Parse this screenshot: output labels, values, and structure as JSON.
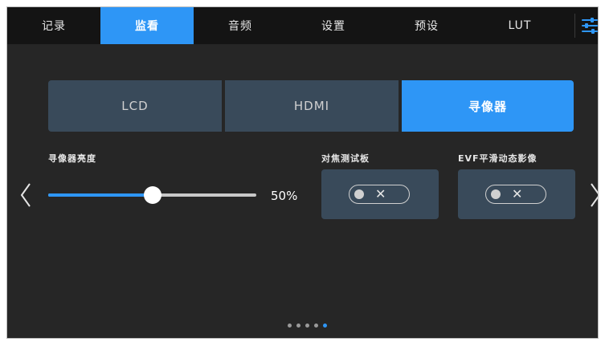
{
  "tabs": [
    {
      "label": "记录",
      "active": false
    },
    {
      "label": "监看",
      "active": true
    },
    {
      "label": "音频",
      "active": false
    },
    {
      "label": "设置",
      "active": false
    },
    {
      "label": "预设",
      "active": false
    },
    {
      "label": "LUT",
      "active": false
    }
  ],
  "menu_icon": "sliders-icon",
  "segments": [
    {
      "label": "LCD",
      "active": false
    },
    {
      "label": "HDMI",
      "active": false
    },
    {
      "label": "寻像器",
      "active": true
    }
  ],
  "brightness": {
    "label": "寻像器亮度",
    "value_text": "50%",
    "value_fraction": 0.5
  },
  "focus_chart": {
    "label": "对焦测试板",
    "state": "off",
    "state_icon": "x-icon"
  },
  "evf_smooth": {
    "label": "EVF平滑动态影像",
    "state": "off",
    "state_icon": "x-icon"
  },
  "page_indicator": {
    "count": 5,
    "current": 5
  },
  "colors": {
    "accent": "#2e96f6",
    "segment": "#394a5a",
    "background": "#262626",
    "topbar": "#141414"
  }
}
